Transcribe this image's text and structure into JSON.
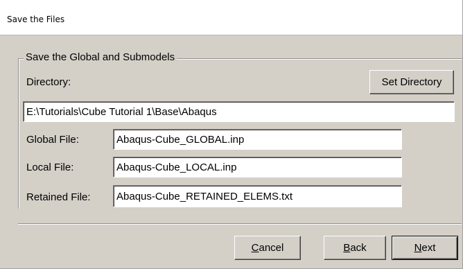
{
  "window": {
    "title": "Save the Files"
  },
  "group": {
    "legend": "Save the Global and Submodels"
  },
  "directory": {
    "label": "Directory:",
    "set_button": "Set Directory",
    "value": "E:\\Tutorials\\Cube Tutorial 1\\Base\\Abaqus"
  },
  "files": {
    "global": {
      "label": "Global File:",
      "value": "Abaqus-Cube_GLOBAL.inp"
    },
    "local": {
      "label": "Local File:",
      "value": "Abaqus-Cube_LOCAL.inp"
    },
    "retained": {
      "label": "Retained File:",
      "value": "Abaqus-Cube_RETAINED_ELEMS.txt"
    }
  },
  "buttons": {
    "cancel": {
      "accel": "C",
      "rest": "ancel"
    },
    "back": {
      "accel": "B",
      "rest": "ack"
    },
    "next": {
      "accel": "N",
      "rest": "ext"
    }
  },
  "colors": {
    "dialog_bg": "#d4d0c8",
    "title_bg": "#ffffff"
  }
}
